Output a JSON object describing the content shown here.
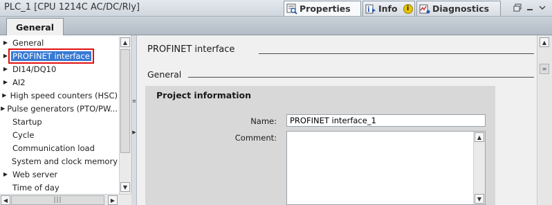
{
  "window": {
    "title": "PLC_1 [CPU 1214C AC/DC/Rly]",
    "tabs": [
      {
        "label": "Properties",
        "icon": "properties-icon",
        "active": true
      },
      {
        "label": "Info",
        "icon": "info-icon",
        "badge_icon": "info-badge-icon",
        "active": false
      },
      {
        "label": "Diagnostics",
        "icon": "diagnostics-icon",
        "active": false
      }
    ],
    "controls": [
      "restore-icon",
      "minimize-icon",
      "collapse-icon"
    ]
  },
  "tabstrip": {
    "general_tab": "General"
  },
  "nav": {
    "items": [
      {
        "label": "General",
        "expandable": true,
        "selected": false
      },
      {
        "label": "PROFINET interface",
        "expandable": true,
        "selected": true
      },
      {
        "label": "DI14/DQ10",
        "expandable": true,
        "selected": false
      },
      {
        "label": "AI2",
        "expandable": true,
        "selected": false
      },
      {
        "label": "High speed counters (HSC)",
        "expandable": true,
        "selected": false
      },
      {
        "label": "Pulse generators (PTO/PW...",
        "expandable": true,
        "selected": false
      },
      {
        "label": "Startup",
        "expandable": false,
        "selected": false
      },
      {
        "label": "Cycle",
        "expandable": false,
        "selected": false
      },
      {
        "label": "Communication load",
        "expandable": false,
        "selected": false
      },
      {
        "label": "System and clock memory",
        "expandable": false,
        "selected": false
      },
      {
        "label": "Web server",
        "expandable": true,
        "selected": false
      },
      {
        "label": "Time of day",
        "expandable": false,
        "selected": false
      }
    ]
  },
  "main": {
    "section_title": "PROFINET interface",
    "subsection_title": "General",
    "project_info": {
      "title": "Project information",
      "name_label": "Name:",
      "name_value": "PROFINET interface_1",
      "comment_label": "Comment:",
      "comment_value": ""
    }
  },
  "colors": {
    "selection": "#3779d4",
    "highlight_box": "#e01010",
    "info_badge": "#e8c400"
  }
}
